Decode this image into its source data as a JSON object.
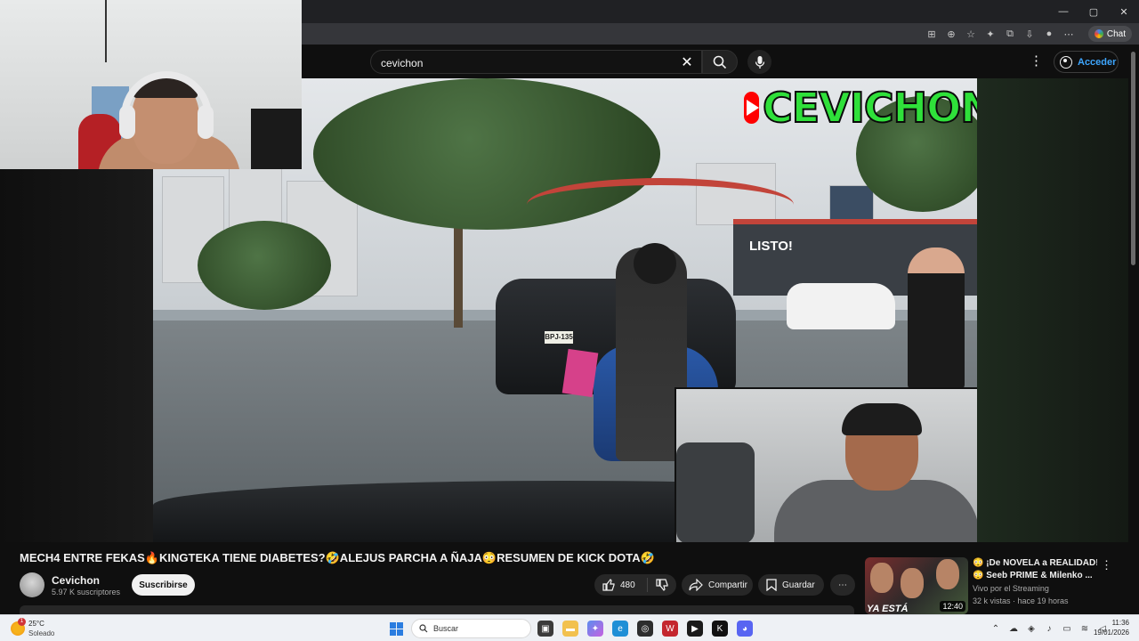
{
  "browser": {
    "window_controls": [
      "—",
      "▢",
      "✕"
    ],
    "chat_label": "Chat"
  },
  "youtube": {
    "search": {
      "query": "cevichon"
    },
    "sign_in_label": "Acceder"
  },
  "video": {
    "overlay_logo_text": "CEVICHON",
    "store_sign": "LISTO!",
    "plate": "BPJ-135",
    "title": "MECH4 ENTRE FEKAS🔥KINGTEKA TIENE DIABETES?🤣ALEJUS PARCHA A ÑAJA😳RESUMEN DE KICK DOTA🤣",
    "channel": "Cevichon",
    "subscribers": "5.97 K suscriptores",
    "subscribe_label": "Suscribirse",
    "likes": "480",
    "share_label": "Compartir",
    "save_label": "Guardar"
  },
  "recommended": {
    "title": "😳 ¡De NOVELA a REALIDAD! 😳 Seeb PRIME & Milenko ...",
    "title_line1": "😳 ¡De NOVELA a REALIDAD!",
    "title_line2": "😳 Seeb PRIME & Milenko ...",
    "channel": "Vivo por el Streaming",
    "views": "32 k vistas · hace 19 horas",
    "duration": "12:40",
    "thumb_text": "YA ESTÁ"
  },
  "taskbar": {
    "weather_temp": "25°C",
    "weather_condition": "Soleado",
    "weather_badge": "1",
    "search_placeholder": "Buscar",
    "time": "11:36",
    "date": "19/01/2026"
  },
  "colors": {
    "yt_bg": "#0f0f0f",
    "accent_blue": "#3ea6ff",
    "logo_green": "#2fe03a",
    "yt_red": "#ff0000"
  }
}
